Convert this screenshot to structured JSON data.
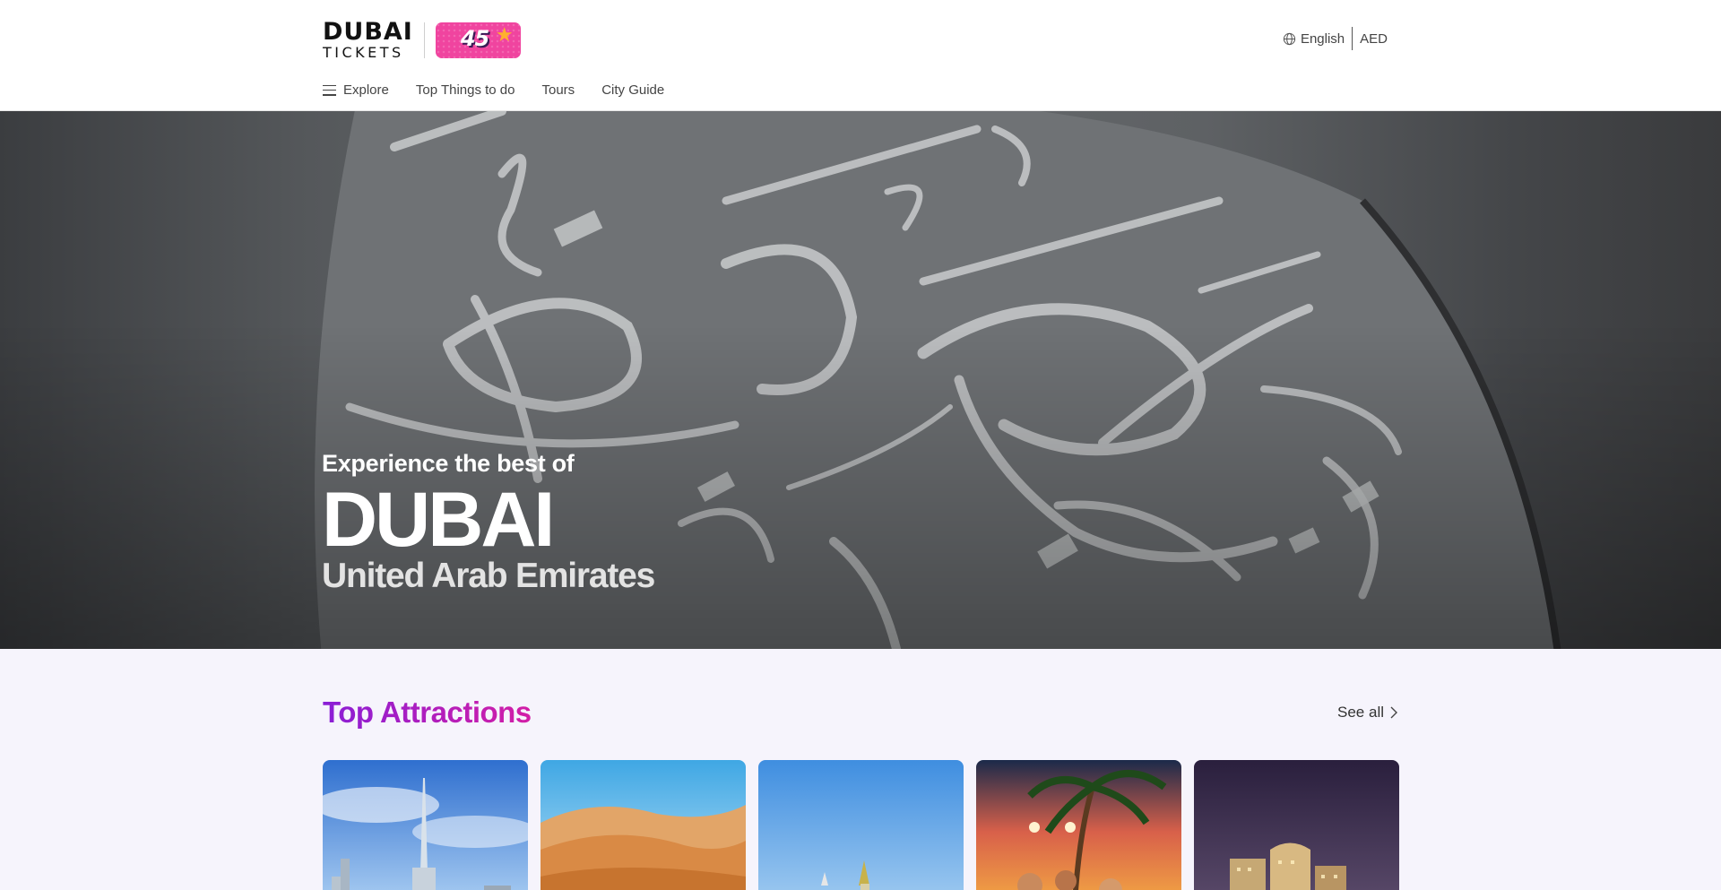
{
  "header": {
    "logo_line1": "DUBAI",
    "logo_line2": "TICKETS",
    "badge_number": "45",
    "locale": {
      "language": "English",
      "currency": "AED"
    },
    "nav": [
      {
        "label": "Explore",
        "icon": "menu-icon"
      },
      {
        "label": "Top Things to do"
      },
      {
        "label": "Tours"
      },
      {
        "label": "City Guide"
      }
    ]
  },
  "hero": {
    "subtitle": "Experience the best of",
    "title": "DUBAI",
    "country": "United Arab Emirates"
  },
  "attractions": {
    "title": "Top Attractions",
    "see_all": "See all",
    "cards": [
      {
        "image": "burj-khalifa-skyline"
      },
      {
        "image": "desert-dunes"
      },
      {
        "image": "mosque-blue-sky"
      },
      {
        "image": "theme-park-palms-sunset"
      },
      {
        "image": "city-night-buildings"
      }
    ]
  },
  "colors": {
    "badge": "#f0449f",
    "accent_start": "#8a1ed6",
    "accent_end": "#d31ea6",
    "page_bg": "#f6f4fc"
  }
}
